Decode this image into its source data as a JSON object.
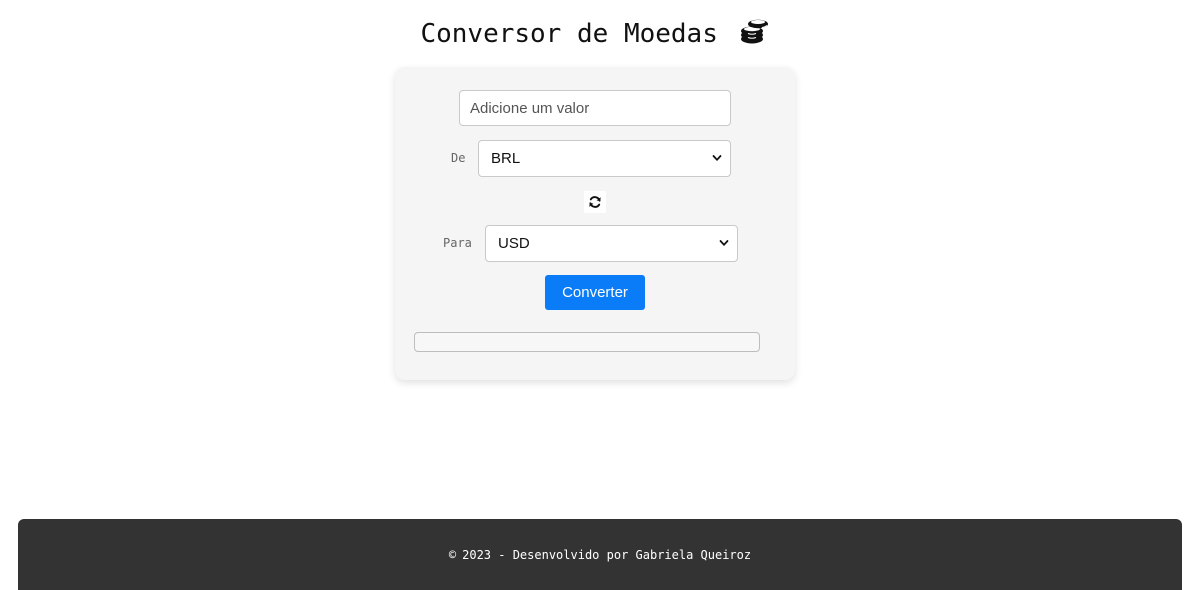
{
  "header": {
    "title": "Conversor de Moedas",
    "icon": "coins-icon"
  },
  "form": {
    "amount": {
      "placeholder": "Adicione um valor",
      "value": ""
    },
    "from": {
      "label": "De",
      "selected": "BRL"
    },
    "swap": {
      "icon": "refresh-icon"
    },
    "to": {
      "label": "Para",
      "selected": "USD"
    },
    "convert_label": "Converter",
    "result": ""
  },
  "footer": {
    "copyright_symbol": "©",
    "text": "2023 - Desenvolvido por Gabriela Queiroz"
  },
  "colors": {
    "primary_button": "#0a7cf7",
    "footer_bg": "#333333",
    "card_bg": "#f5f5f5"
  }
}
